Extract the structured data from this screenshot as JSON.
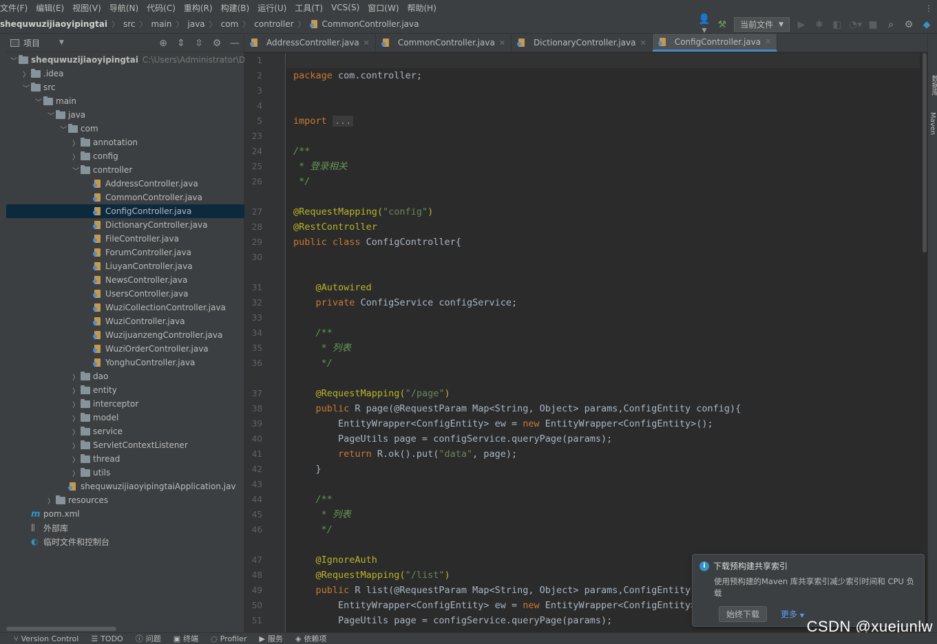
{
  "menu": [
    "文件(F)",
    "编辑(E)",
    "视图(V)",
    "导航(N)",
    "代码(C)",
    "重构(R)",
    "构建(B)",
    "运行(U)",
    "工具(T)",
    "VCS(S)",
    "窗口(W)",
    "帮助(H)"
  ],
  "breadcrumb": {
    "project": "shequwuzijiaoyipingtai",
    "parts": [
      "src",
      "main",
      "java",
      "com",
      "controller"
    ],
    "file": "CommonController.java"
  },
  "toolbar": {
    "run_config": "当前文件"
  },
  "project_panel": {
    "title": "项目"
  },
  "tree": [
    {
      "label": "shequwuzijiaoyipingtai",
      "hint": "C:\\Users\\Administrator\\De",
      "kind": "root"
    },
    {
      "label": ".idea",
      "kind": "folder"
    },
    {
      "label": "src",
      "kind": "folder"
    },
    {
      "label": "main",
      "kind": "folder"
    },
    {
      "label": "java",
      "kind": "folder"
    },
    {
      "label": "com",
      "kind": "folder"
    },
    {
      "label": "annotation",
      "kind": "folder"
    },
    {
      "label": "config",
      "kind": "folder"
    },
    {
      "label": "controller",
      "kind": "folder"
    },
    {
      "label": "AddressController.java",
      "kind": "java"
    },
    {
      "label": "CommonController.java",
      "kind": "java"
    },
    {
      "label": "ConfigController.java",
      "kind": "java",
      "selected": true
    },
    {
      "label": "DictionaryController.java",
      "kind": "java"
    },
    {
      "label": "FileController.java",
      "kind": "java"
    },
    {
      "label": "ForumController.java",
      "kind": "java"
    },
    {
      "label": "LiuyanController.java",
      "kind": "java"
    },
    {
      "label": "NewsController.java",
      "kind": "java"
    },
    {
      "label": "UsersController.java",
      "kind": "java"
    },
    {
      "label": "WuziCollectionController.java",
      "kind": "java"
    },
    {
      "label": "WuziController.java",
      "kind": "java"
    },
    {
      "label": "WuzijuanzengController.java",
      "kind": "java"
    },
    {
      "label": "WuziOrderController.java",
      "kind": "java"
    },
    {
      "label": "YonghuController.java",
      "kind": "java"
    },
    {
      "label": "dao",
      "kind": "folder"
    },
    {
      "label": "entity",
      "kind": "folder"
    },
    {
      "label": "interceptor",
      "kind": "folder"
    },
    {
      "label": "model",
      "kind": "folder"
    },
    {
      "label": "service",
      "kind": "folder"
    },
    {
      "label": "ServletContextListener",
      "kind": "folder"
    },
    {
      "label": "thread",
      "kind": "folder"
    },
    {
      "label": "utils",
      "kind": "folder"
    },
    {
      "label": "shequwuzijiaoyipingtaiApplication.jav",
      "kind": "java"
    },
    {
      "label": "resources",
      "kind": "folder"
    },
    {
      "label": "pom.xml",
      "kind": "maven"
    },
    {
      "label": "外部库",
      "kind": "lib"
    },
    {
      "label": "临时文件和控制台",
      "kind": "scratch"
    }
  ],
  "tabs": [
    {
      "label": "AddressController.java",
      "active": false
    },
    {
      "label": "CommonController.java",
      "active": false
    },
    {
      "label": "DictionaryController.java",
      "active": false
    },
    {
      "label": "ConfigController.java",
      "active": true
    }
  ],
  "line_numbers": [
    "1",
    "2",
    "3",
    "4",
    "5",
    "23",
    "24",
    "25",
    "26",
    "27",
    "28",
    "29",
    "30",
    "31",
    "32",
    "33",
    "34",
    "35",
    "36",
    "37",
    "38",
    "39",
    "40",
    "41",
    "42",
    "43",
    "44",
    "45",
    "46",
    "47",
    "48",
    "49",
    "50",
    "51"
  ],
  "code": {
    "l2a": "package",
    "l2b": " com.controller;",
    "l5a": "import",
    "l5b": "...",
    "l24": "/**",
    "l25": " * 登录相关",
    "l26": " */",
    "l27a": "@RequestMapping(",
    "l27b": "\"config\"",
    "l27c": ")",
    "l28": "@RestController",
    "l29a": "public class",
    "l29b": " ConfigController{",
    "l31": "    @Autowired",
    "l32a": "    private",
    "l32b": " ConfigService configService;",
    "l34": "    /**",
    "l35": "     * 列表",
    "l36": "     */",
    "l37a": "    @RequestMapping(",
    "l37b": "\"/page\"",
    "l37c": ")",
    "l38a": "    public",
    "l38b": " R page(@RequestParam Map<String, Object> params,ConfigEntity config){",
    "l39a": "        EntityWrapper<ConfigEntity> ew = ",
    "l39b": "new",
    "l39c": " EntityWrapper<ConfigEntity>();",
    "l40": "        PageUtils page = configService.queryPage(params);",
    "l41a": "        return",
    "l41b": " R.ok().put(",
    "l41c": "\"data\"",
    "l41d": ", page);",
    "l42": "    }",
    "l44": "    /**",
    "l45": "     * 列表",
    "l46": "     */",
    "l47": "    @IgnoreAuth",
    "l48a": "    @RequestMapping(",
    "l48b": "\"/list\"",
    "l48c": ")",
    "l49a": "    public",
    "l49b": " R list(@RequestParam Map<String, Object> params,ConfigEntity c",
    "l50a": "        EntityWrapper<ConfigEntity> ew = ",
    "l50b": "new",
    "l50c": " EntityWrapper<ConfigEntity>(",
    "l51": "        PageUtils page = configService.queryPage(params);"
  },
  "notification": {
    "title": "下载预构建共享索引",
    "body": "使用预构建的Maven 库共享索引减少索引时间和 CPU 负载",
    "primary": "始终下载",
    "more": "更多"
  },
  "right_tools": [
    "数据库",
    "Maven"
  ],
  "statusbar": [
    "Version Control",
    "TODO",
    "问题",
    "终端",
    "Profiler",
    "服务",
    "依赖项"
  ],
  "watermark": "CSDN @xuejunlw"
}
